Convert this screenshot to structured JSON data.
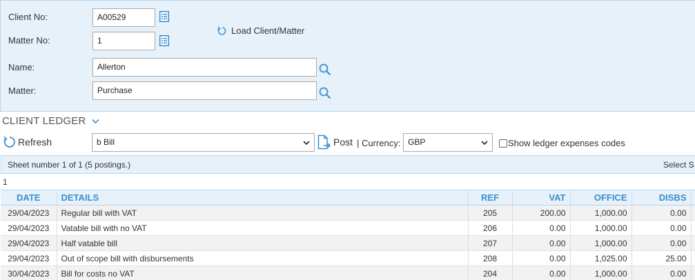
{
  "client_form": {
    "client_no_label": "Client No:",
    "client_no_value": "A00529",
    "matter_no_label": "Matter No:",
    "matter_no_value": "1",
    "name_label": "Name:",
    "name_value": "Allerton",
    "matter_label": "Matter:",
    "matter_value": "Purchase",
    "load_label": "Load Client/Matter"
  },
  "ledger": {
    "section_title": "CLIENT LEDGER",
    "refresh_label": "Refresh",
    "filter_value": "b Bill",
    "post_label": "Post",
    "currency_label": "| Currency:",
    "currency_value": "GBP",
    "show_expenses_label": "Show ledger expenses codes",
    "sheet_info": "Sheet number 1 of 1 (5 postings.)",
    "select_label": "Select S",
    "page_number": "1",
    "columns": {
      "date": "DATE",
      "details": "DETAILS",
      "ref": "REF",
      "vat": "VAT",
      "office": "OFFICE",
      "disbs": "DISBS"
    },
    "rows": [
      {
        "date": "29/04/2023",
        "details": "Regular bill with VAT",
        "ref": "205",
        "vat": "200.00",
        "office": "1,000.00",
        "disbs": "0.00"
      },
      {
        "date": "29/04/2023",
        "details": "Vatable bill with no VAT",
        "ref": "206",
        "vat": "0.00",
        "office": "1,000.00",
        "disbs": "0.00"
      },
      {
        "date": "29/04/2023",
        "details": "Half vatable bill",
        "ref": "207",
        "vat": "0.00",
        "office": "1,000.00",
        "disbs": "0.00"
      },
      {
        "date": "29/04/2023",
        "details": "Out of scope bill with disbursements",
        "ref": "208",
        "vat": "0.00",
        "office": "1,025.00",
        "disbs": "25.00"
      },
      {
        "date": "30/04/2023",
        "details": "Bill for costs no VAT",
        "ref": "204",
        "vat": "0.00",
        "office": "1,000.00",
        "disbs": "0.00"
      }
    ]
  },
  "colors": {
    "accent": "#3a8fcf",
    "panel_bg": "#e6f1fa",
    "negative": "#e2231a"
  }
}
